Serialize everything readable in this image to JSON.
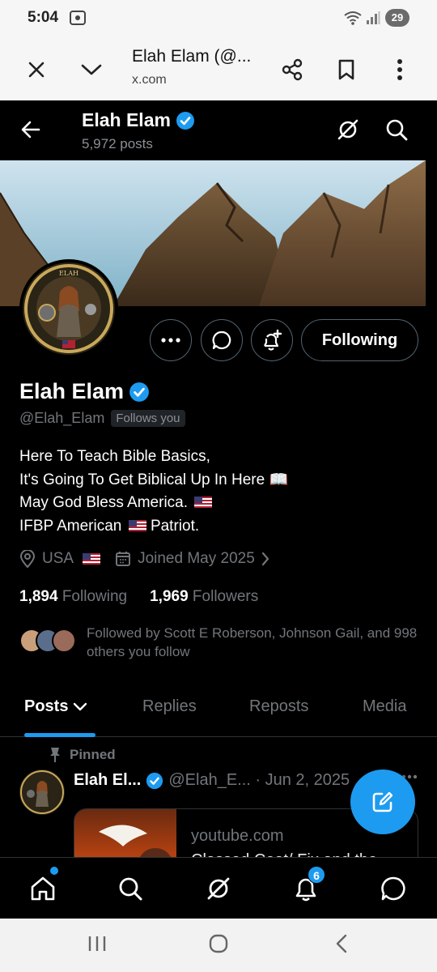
{
  "status_bar": {
    "time": "5:04",
    "battery": "29"
  },
  "browser": {
    "title": "Elah Elam (@...",
    "domain": "x.com"
  },
  "header": {
    "name": "Elah Elam",
    "posts_count": "5,972 posts"
  },
  "profile": {
    "name": "Elah Elam",
    "handle": "@Elah_Elam",
    "follows_you": "Follows you",
    "bio": [
      "Here To Teach Bible Basics,",
      "It's Going To Get Biblical Up In Here 📖",
      "May God Bless America.",
      "IFBP American",
      "Patriot."
    ],
    "location": "USA",
    "joined": "Joined May 2025",
    "following_count": "1,894",
    "following_label": "Following",
    "followers_count": "1,969",
    "followers_label": "Followers",
    "followed_by": "Followed by Scott E Roberson, Johnson Gail, and 998 others you follow"
  },
  "actions": {
    "following_button": "Following"
  },
  "tabs": [
    "Posts",
    "Replies",
    "Reposts",
    "Media"
  ],
  "pinned_post": {
    "pinned_label": "Pinned",
    "author": "Elah El...",
    "handle_date": "@Elah_E... · Jun 2, 2025",
    "card_domain": "youtube.com",
    "card_title": "Classed Coat/ Fix and the"
  },
  "bottom_nav": {
    "notifications_badge": "6"
  },
  "icons": [
    "close-icon",
    "chevron-down-icon",
    "share-icon",
    "bookmark-icon",
    "more-vertical-icon",
    "back-arrow-icon",
    "grok-icon",
    "search-icon",
    "verified-badge-icon",
    "more-horizontal-icon",
    "chat-icon",
    "notification-add-icon",
    "location-icon",
    "calendar-icon",
    "chevron-right-icon",
    "pin-icon",
    "compose-icon",
    "home-icon",
    "bell-icon",
    "messages-icon"
  ],
  "colors": {
    "accent": "#1d9bf0",
    "background": "#000000",
    "text": "#e7e9ea",
    "muted": "#71767b"
  }
}
